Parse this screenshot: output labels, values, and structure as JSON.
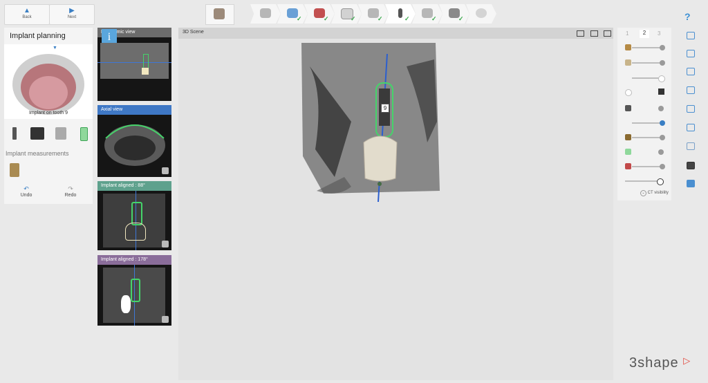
{
  "toolbar": {
    "back_label": "Back",
    "next_label": "Next",
    "help_label": "?"
  },
  "workflow": {
    "steps": [
      {
        "icon": "patient-icon",
        "done": false
      },
      {
        "icon": "scan-import-icon",
        "done": true
      },
      {
        "icon": "segmentation-icon",
        "done": true
      },
      {
        "icon": "tooth-icon",
        "done": true
      },
      {
        "icon": "nerve-icon",
        "done": true
      },
      {
        "icon": "implant-icon",
        "done": true,
        "active": true
      },
      {
        "icon": "guide-icon",
        "done": true
      },
      {
        "icon": "sleeve-icon",
        "done": true
      },
      {
        "icon": "export-icon",
        "done": false
      }
    ]
  },
  "left_panel": {
    "title": "Implant planning",
    "caption": "Implant on tooth 9",
    "measurements_label": "Implant measurements",
    "undo_label": "Undo",
    "redo_label": "Redo"
  },
  "views": {
    "panoramic": "Panoramic view",
    "axial": "Axial view",
    "aligned1": "Implant aligned : 88°",
    "aligned2": "Implant aligned : 178°"
  },
  "scene": {
    "title": "3D Scene",
    "tooth_label": "9"
  },
  "right_panel": {
    "page_prev": "1",
    "page_current": "2",
    "page_next": "3",
    "ct_visibility": "CT visibility",
    "slider_levels": [
      0.92,
      0.92,
      0.88,
      0.0,
      0.92,
      0.92,
      0.92,
      0.92,
      0.92,
      0.92
    ]
  },
  "brand": {
    "logo": "3shape"
  },
  "colors": {
    "accent": "#3a7fc4",
    "check": "#37a84a",
    "implant_green": "#45d46a",
    "axis_blue": "#2b5fcf"
  }
}
